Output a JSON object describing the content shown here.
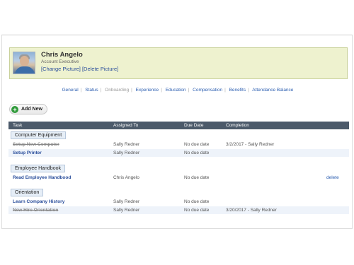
{
  "profile": {
    "name": "Chris Angelo",
    "title": "Account Executive",
    "change_picture": "[Change Picture]",
    "delete_picture": "[Delete Picture]"
  },
  "nav": [
    {
      "label": "General"
    },
    {
      "label": "Status"
    },
    {
      "label": "Onboarding"
    },
    {
      "label": "Experience"
    },
    {
      "label": "Education"
    },
    {
      "label": "Compensation"
    },
    {
      "label": "Benefits"
    },
    {
      "label": "Attendance Balance"
    }
  ],
  "toolbar": {
    "add_new": "Add New"
  },
  "table": {
    "headers": [
      "Task",
      "Assigned To",
      "Due Date",
      "Completion"
    ],
    "groups": [
      {
        "name": "Computer Equipment",
        "rows": [
          {
            "task": "Setup New Computer",
            "assigned": "Sally Redner",
            "due": "No due date",
            "completion": "3/2/2017 - Sally Redner",
            "done": true,
            "action": ""
          },
          {
            "task": "Setup Printer",
            "assigned": "Sally Redner",
            "due": "No due date",
            "completion": "",
            "done": false,
            "action": ""
          }
        ]
      },
      {
        "name": "Employee Handbook",
        "rows": [
          {
            "task": "Read Employee Handbood",
            "assigned": "Chris Angelo",
            "due": "No due date",
            "completion": "",
            "done": false,
            "action": "delete"
          }
        ]
      },
      {
        "name": "Orientation",
        "rows": [
          {
            "task": "Learn Company History",
            "assigned": "Sally Redner",
            "due": "No due date",
            "completion": "",
            "done": false,
            "action": ""
          },
          {
            "task": "New Hire Orientation",
            "assigned": "Sally Redner",
            "due": "No due date",
            "completion": "3/20/2017 - Sally Redner",
            "done": true,
            "action": ""
          }
        ]
      }
    ]
  }
}
